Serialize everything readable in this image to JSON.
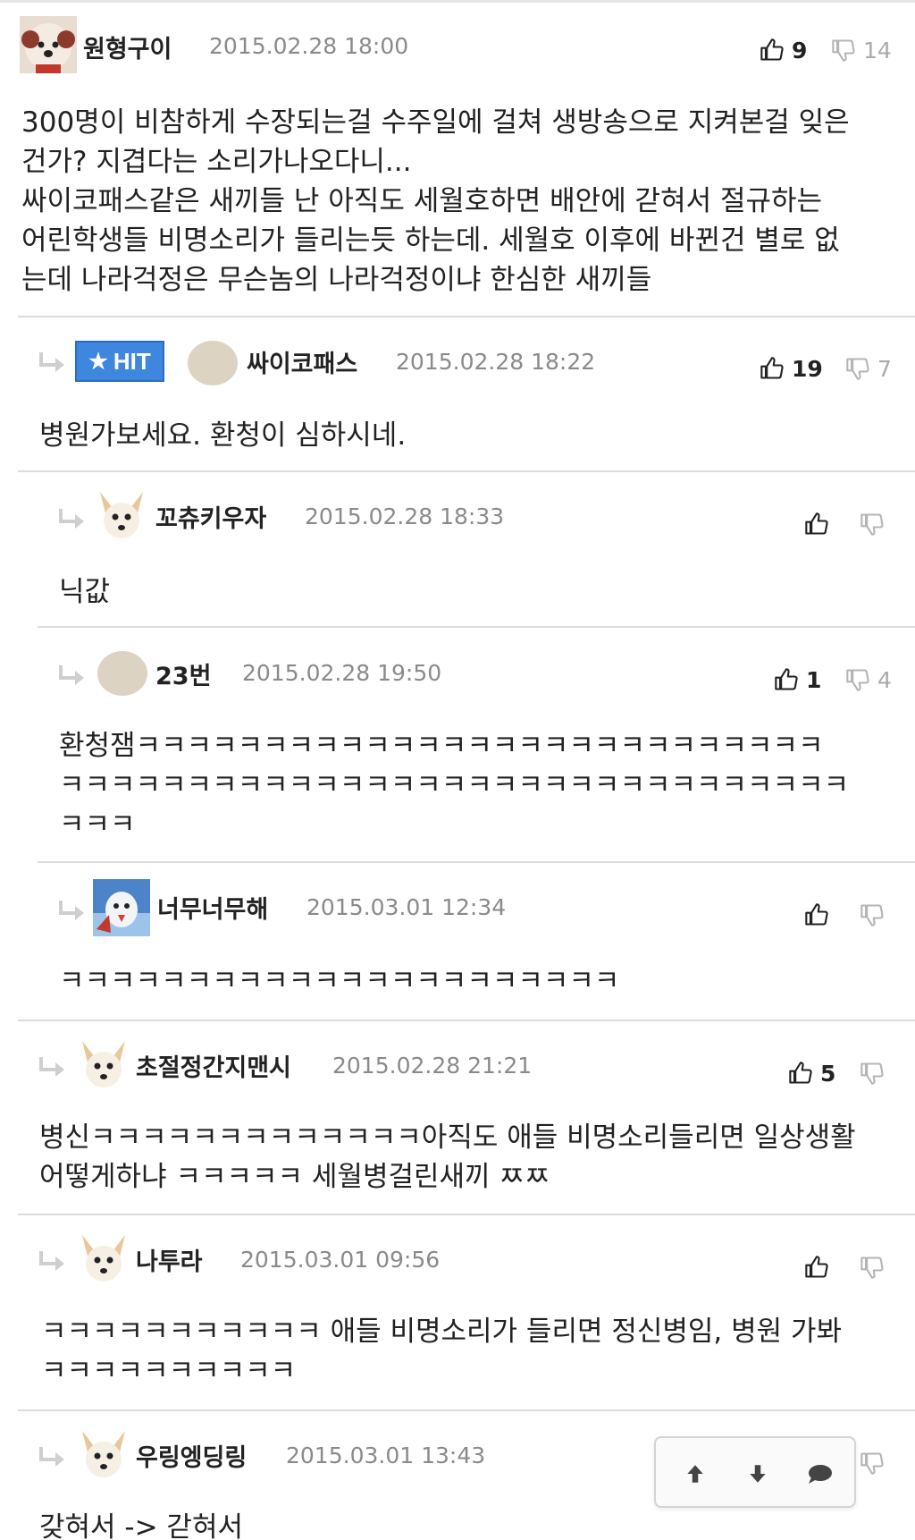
{
  "comments": [
    {
      "nick": "원형구이",
      "date": "2015.02.28 18:00",
      "up": "9",
      "down": "14",
      "lines": [
        "300명이 비참하게 수장되는걸 수주일에 걸쳐 생방송으로 지켜본걸 잊은",
        "건가? 지겹다는 소리가나오다니...",
        "싸이코패스같은 새끼들 난 아직도 세월호하면 배안에 갇혀서 절규하는",
        "어린학생들 비명소리가 들리는듯 하는데. 세월호 이후에 바뀐건 별로 없",
        "는데 나라걱정은 무슨놈의 나라걱정이냐 한심한 새끼들"
      ]
    },
    {
      "badge": "HIT",
      "nick": "싸이코패스",
      "date": "2015.02.28 18:22",
      "up": "19",
      "down": "7",
      "lines": [
        "병원가보세요. 환청이 심하시네."
      ]
    },
    {
      "nick": "꼬츄키우자",
      "date": "2015.02.28 18:33",
      "up": "",
      "down": "",
      "lines": [
        "닉값"
      ]
    },
    {
      "nick": "23번",
      "date": "2015.02.28 19:50",
      "up": "1",
      "down": "4",
      "lines": [
        "환청잼ㅋㅋㅋㅋㅋㅋㅋㅋㅋㅋㅋㅋㅋㅋㅋㅋㅋㅋㅋㅋㅋㅋㅋㅋㅋㅋㅋ",
        "ㅋㅋㅋㅋㅋㅋㅋㅋㅋㅋㅋㅋㅋㅋㅋㅋㅋㅋㅋㅋㅋㅋㅋㅋㅋㅋㅋㅋㅋㅋㅋ",
        "ㅋㅋㅋ"
      ]
    },
    {
      "nick": "너무너무해",
      "date": "2015.03.01 12:34",
      "up": "",
      "down": "",
      "lines": [
        "ㅋㅋㅋㅋㅋㅋㅋㅋㅋㅋㅋㅋㅋㅋㅋㅋㅋㅋㅋㅋㅋㅋ"
      ]
    },
    {
      "nick": "초절정간지맨시",
      "date": "2015.02.28 21:21",
      "up": "5",
      "down": "",
      "lines": [
        "병신ㅋㅋㅋㅋㅋㅋㅋㅋㅋㅋㅋㅋㅋ아직도 애들 비명소리들리면 일상생활",
        "어떻게하냐 ㅋㅋㅋㅋㅋ 세월병걸린새끼 ㅉㅉ"
      ]
    },
    {
      "nick": "나투라",
      "date": "2015.03.01 09:56",
      "up": "",
      "down": "",
      "lines": [
        "ㅋㅋㅋㅋㅋㅋㅋㅋㅋㅋㅋ 애들 비명소리가 들리면 정신병임, 병원 가봐",
        "ㅋㅋㅋㅋㅋㅋㅋㅋㅋㅋ"
      ]
    },
    {
      "nick": "우링엥딩링",
      "date": "2015.03.01 13:43",
      "up": "",
      "down": "",
      "lines": [
        "갖혀서 -> 갇혀서"
      ]
    }
  ],
  "icons": {
    "thumb_up": "thumbs-up-icon",
    "thumb_down": "thumbs-down-icon",
    "reply": "reply-arrow-icon",
    "float": [
      "arrow-up-icon",
      "arrow-down-icon",
      "speech-bubble-icon"
    ]
  },
  "colors": {
    "hit_badge": "#3f86de",
    "date": "#8a8a8a",
    "down_count": "#aaaaaa",
    "divider": "#dcdcdc"
  }
}
